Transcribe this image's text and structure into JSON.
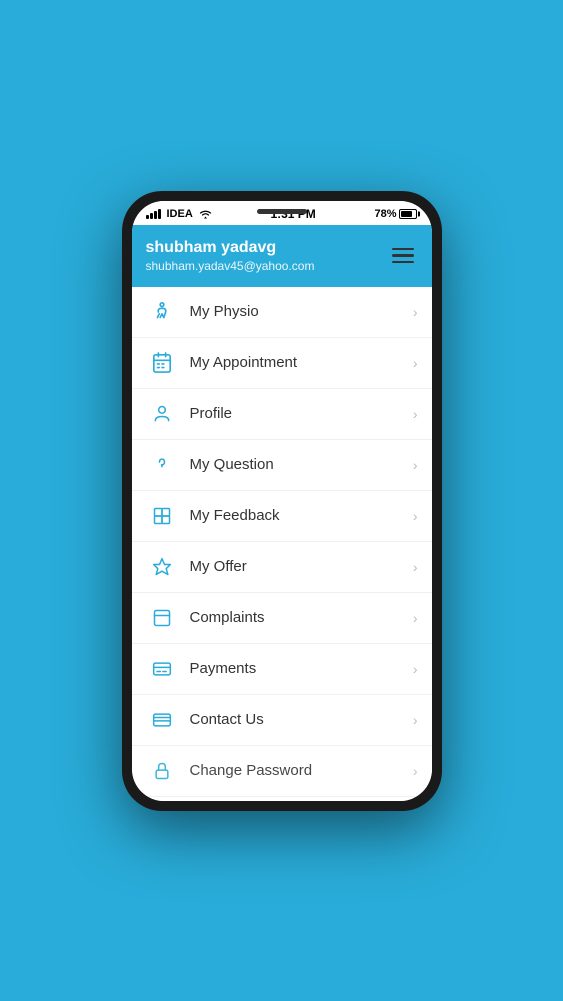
{
  "statusBar": {
    "carrier": "IDEA",
    "time": "1:31 PM",
    "battery": "78%"
  },
  "header": {
    "name": "shubham yadavg",
    "email": "shubham.yadav45@yahoo.com"
  },
  "menuItems": [
    {
      "id": "my-physio",
      "label": "My Physio",
      "icon": "physio"
    },
    {
      "id": "my-appointment",
      "label": "My Appointment",
      "icon": "appointment"
    },
    {
      "id": "profile",
      "label": "Profile",
      "icon": "profile"
    },
    {
      "id": "my-question",
      "label": "My Question",
      "icon": "question"
    },
    {
      "id": "my-feedback",
      "label": "My Feedback",
      "icon": "feedback"
    },
    {
      "id": "my-offer",
      "label": "My Offer",
      "icon": "offer"
    },
    {
      "id": "complaints",
      "label": "Complaints",
      "icon": "complaints"
    },
    {
      "id": "payments",
      "label": "Payments",
      "icon": "payments"
    },
    {
      "id": "contact-us",
      "label": "Contact Us",
      "icon": "contact"
    },
    {
      "id": "change-password",
      "label": "Change Password",
      "icon": "password"
    }
  ]
}
